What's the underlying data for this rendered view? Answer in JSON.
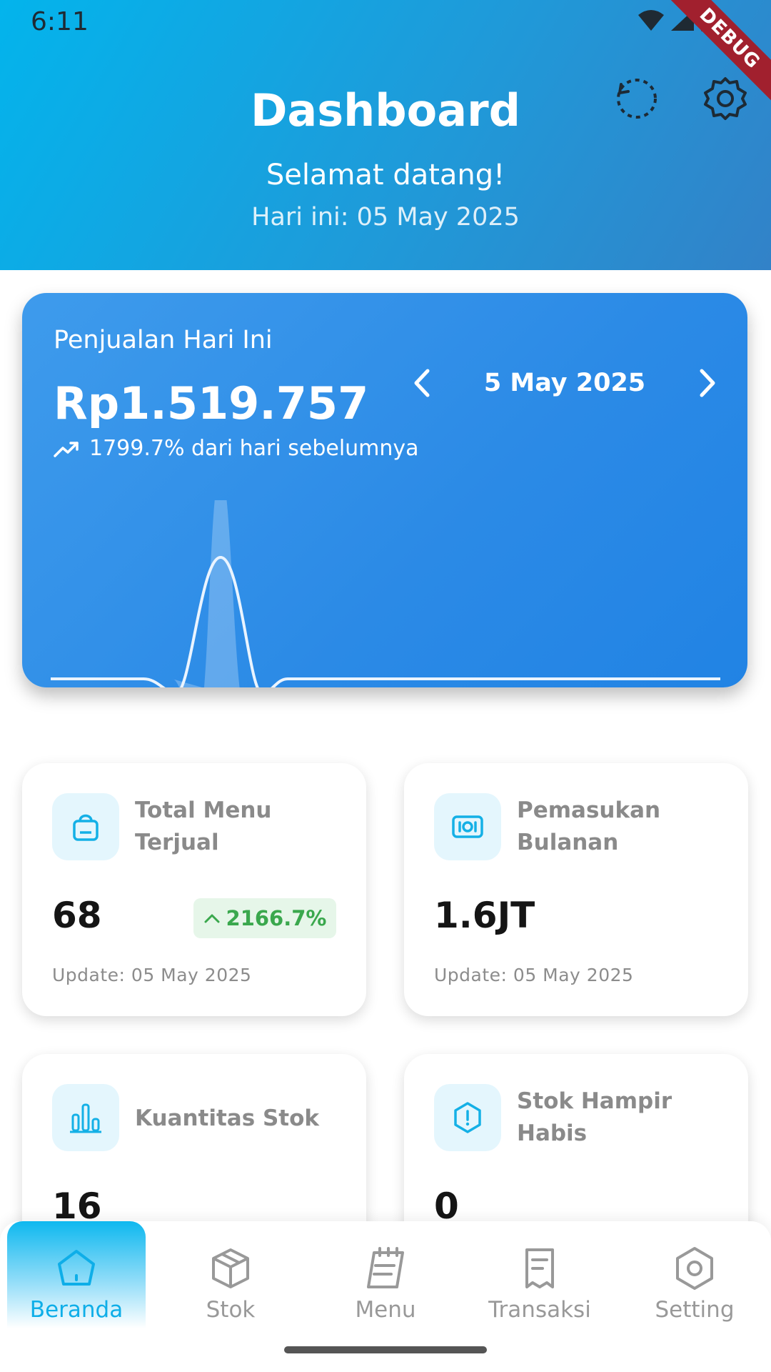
{
  "status_bar": {
    "time": "6:11",
    "debug_label": "DEBUG"
  },
  "header": {
    "title": "Dashboard",
    "greeting": "Selamat datang!",
    "today": "Hari ini: 05 May 2025"
  },
  "sales": {
    "label": "Penjualan Hari Ini",
    "amount": "Rp1.519.757",
    "change": "1799.7% dari hari sebelumnya",
    "date": "5 May 2025"
  },
  "stats": [
    {
      "title": "Total Menu Terjual",
      "value": "68",
      "badge": "2166.7%",
      "update": "Update: 05 May 2025",
      "icon": "shopping-bag-icon"
    },
    {
      "title": "Pemasukan Bulanan",
      "value": "1.6JT",
      "update": "Update: 05 May 2025",
      "icon": "money-icon"
    },
    {
      "title": "Kuantitas Stok",
      "value": "16",
      "icon": "bar-chart-icon"
    },
    {
      "title": "Stok Hampir Habis",
      "value": "0",
      "icon": "alert-hexagon-icon"
    }
  ],
  "nav": [
    {
      "label": "Beranda",
      "icon": "home-icon",
      "active": true
    },
    {
      "label": "Stok",
      "icon": "box-icon"
    },
    {
      "label": "Menu",
      "icon": "notebook-icon"
    },
    {
      "label": "Transaksi",
      "icon": "receipt-icon"
    },
    {
      "label": "Setting",
      "icon": "settings-hexagon-icon"
    }
  ],
  "colors": {
    "accent": "#0eaee8",
    "header_start": "#03b4ec",
    "card_blue": "#2b8ae6",
    "positive": "#3aa84d"
  }
}
